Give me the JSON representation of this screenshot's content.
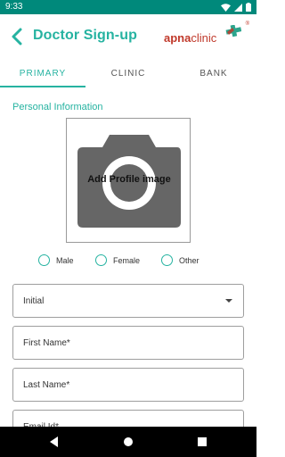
{
  "status_bar": {
    "time": "9:33"
  },
  "header": {
    "title": "Doctor Sign-up",
    "back_icon": "arrow-back-icon"
  },
  "brand": {
    "part1": "apna",
    "part2": "clinic",
    "reg": "®",
    "accent": "#c0392b",
    "cross_color": "#2ca58d"
  },
  "colors": {
    "accent": "#26b3a1",
    "status_bar": "#00897b"
  },
  "tabs": [
    {
      "label": "PRIMARY",
      "active": true
    },
    {
      "label": "CLINIC",
      "active": false
    },
    {
      "label": "BANK",
      "active": false
    }
  ],
  "section": {
    "title": "Personal Information"
  },
  "profile": {
    "label": "Add Profile image",
    "icon": "camera-icon"
  },
  "gender": {
    "options": [
      "Male",
      "Female",
      "Other"
    ]
  },
  "fields": {
    "initial": {
      "value": "Initial"
    },
    "first_name": {
      "placeholder": "First Name*"
    },
    "last_name": {
      "placeholder": "Last Name*"
    },
    "email": {
      "placeholder": "Email Id*"
    }
  }
}
